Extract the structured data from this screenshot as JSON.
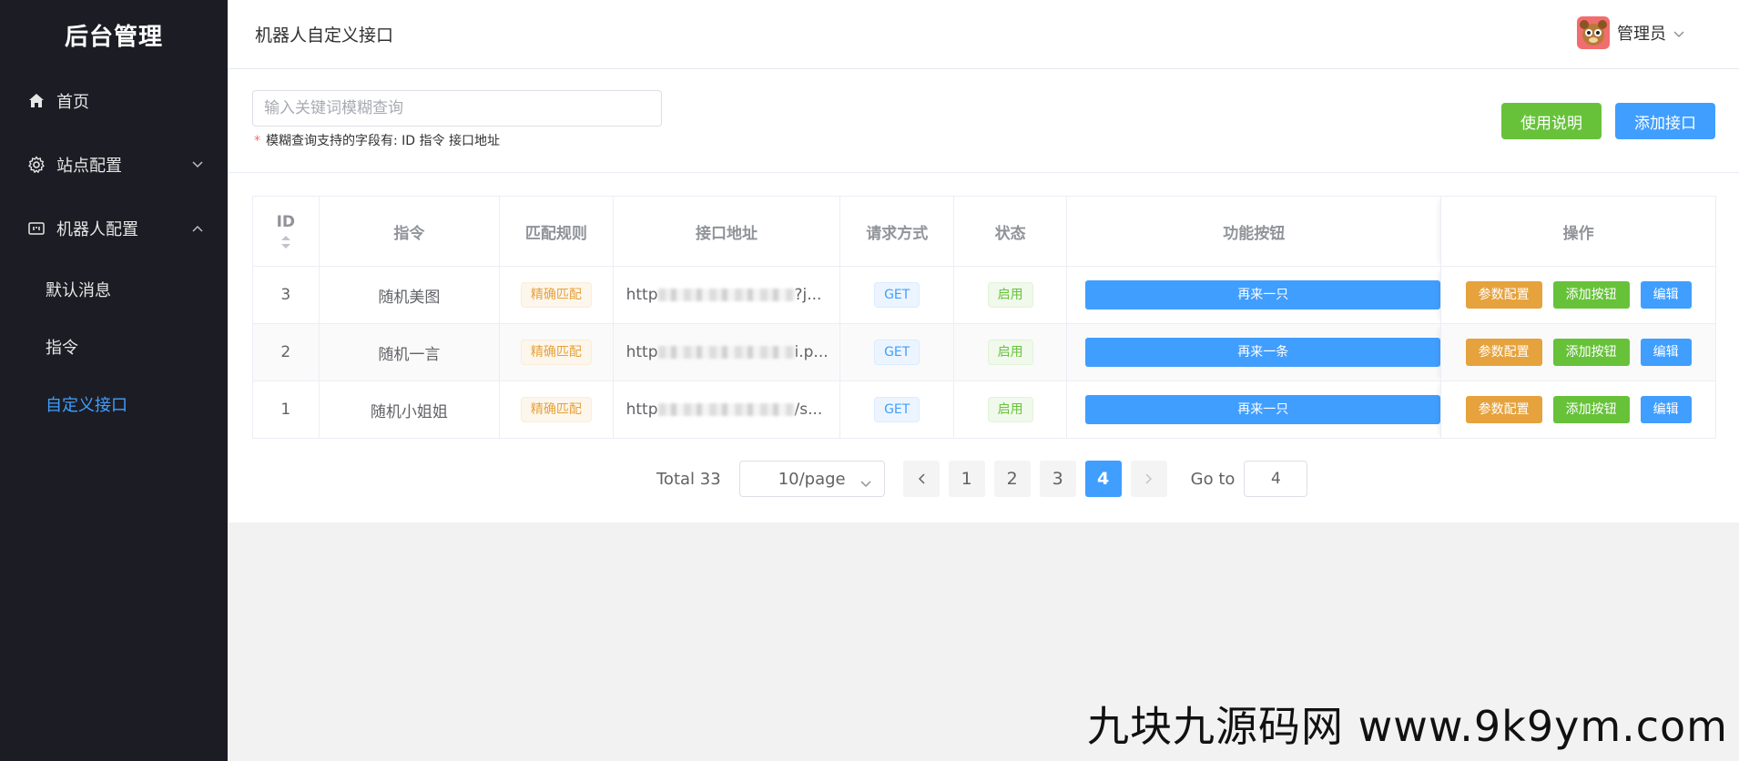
{
  "sidebar": {
    "logo": "后台管理",
    "items": [
      {
        "label": "首页",
        "icon": "home-icon"
      },
      {
        "label": "站点配置",
        "icon": "gear-icon"
      },
      {
        "label": "机器人配置",
        "icon": "robot-icon"
      }
    ],
    "sub_items": [
      {
        "label": "默认消息"
      },
      {
        "label": "指令"
      },
      {
        "label": "自定义接口",
        "active": true
      }
    ]
  },
  "header": {
    "title": "机器人自定义接口",
    "user_name": "管理员"
  },
  "search": {
    "placeholder": "输入关键词模糊查询",
    "hint": "模糊查询支持的字段有: ID 指令 接口地址",
    "help_button": "使用说明",
    "add_button": "添加接口"
  },
  "table": {
    "columns": [
      "ID",
      "指令",
      "匹配规则",
      "接口地址",
      "请求方式",
      "状态",
      "功能按钮",
      "操作"
    ],
    "rows": [
      {
        "id": "3",
        "command": "随机美图",
        "match": "精确匹配",
        "url_prefix": "http",
        "url_suffix": "?j...",
        "method": "GET",
        "status": "启用",
        "func": "再来一只"
      },
      {
        "id": "2",
        "command": "随机一言",
        "match": "精确匹配",
        "url_prefix": "http",
        "url_suffix": "i.p...",
        "method": "GET",
        "status": "启用",
        "func": "再来一条"
      },
      {
        "id": "1",
        "command": "随机小姐姐",
        "match": "精确匹配",
        "url_prefix": "http",
        "url_suffix": "/s...",
        "method": "GET",
        "status": "启用",
        "func": "再来一只"
      }
    ],
    "actions": {
      "param": "参数配置",
      "add_btn": "添加按钮",
      "edit": "编辑"
    }
  },
  "pagination": {
    "total": "Total 33",
    "page_size": "10/page",
    "pages": [
      "1",
      "2",
      "3",
      "4"
    ],
    "current": "4",
    "goto_label": "Go to",
    "goto_value": "4"
  },
  "watermark": "九块九源码网 www.9k9ym.com",
  "colors": {
    "primary": "#409eff",
    "success": "#67c23a",
    "warning": "#e6a23c",
    "sidebar": "#1c1d24"
  }
}
